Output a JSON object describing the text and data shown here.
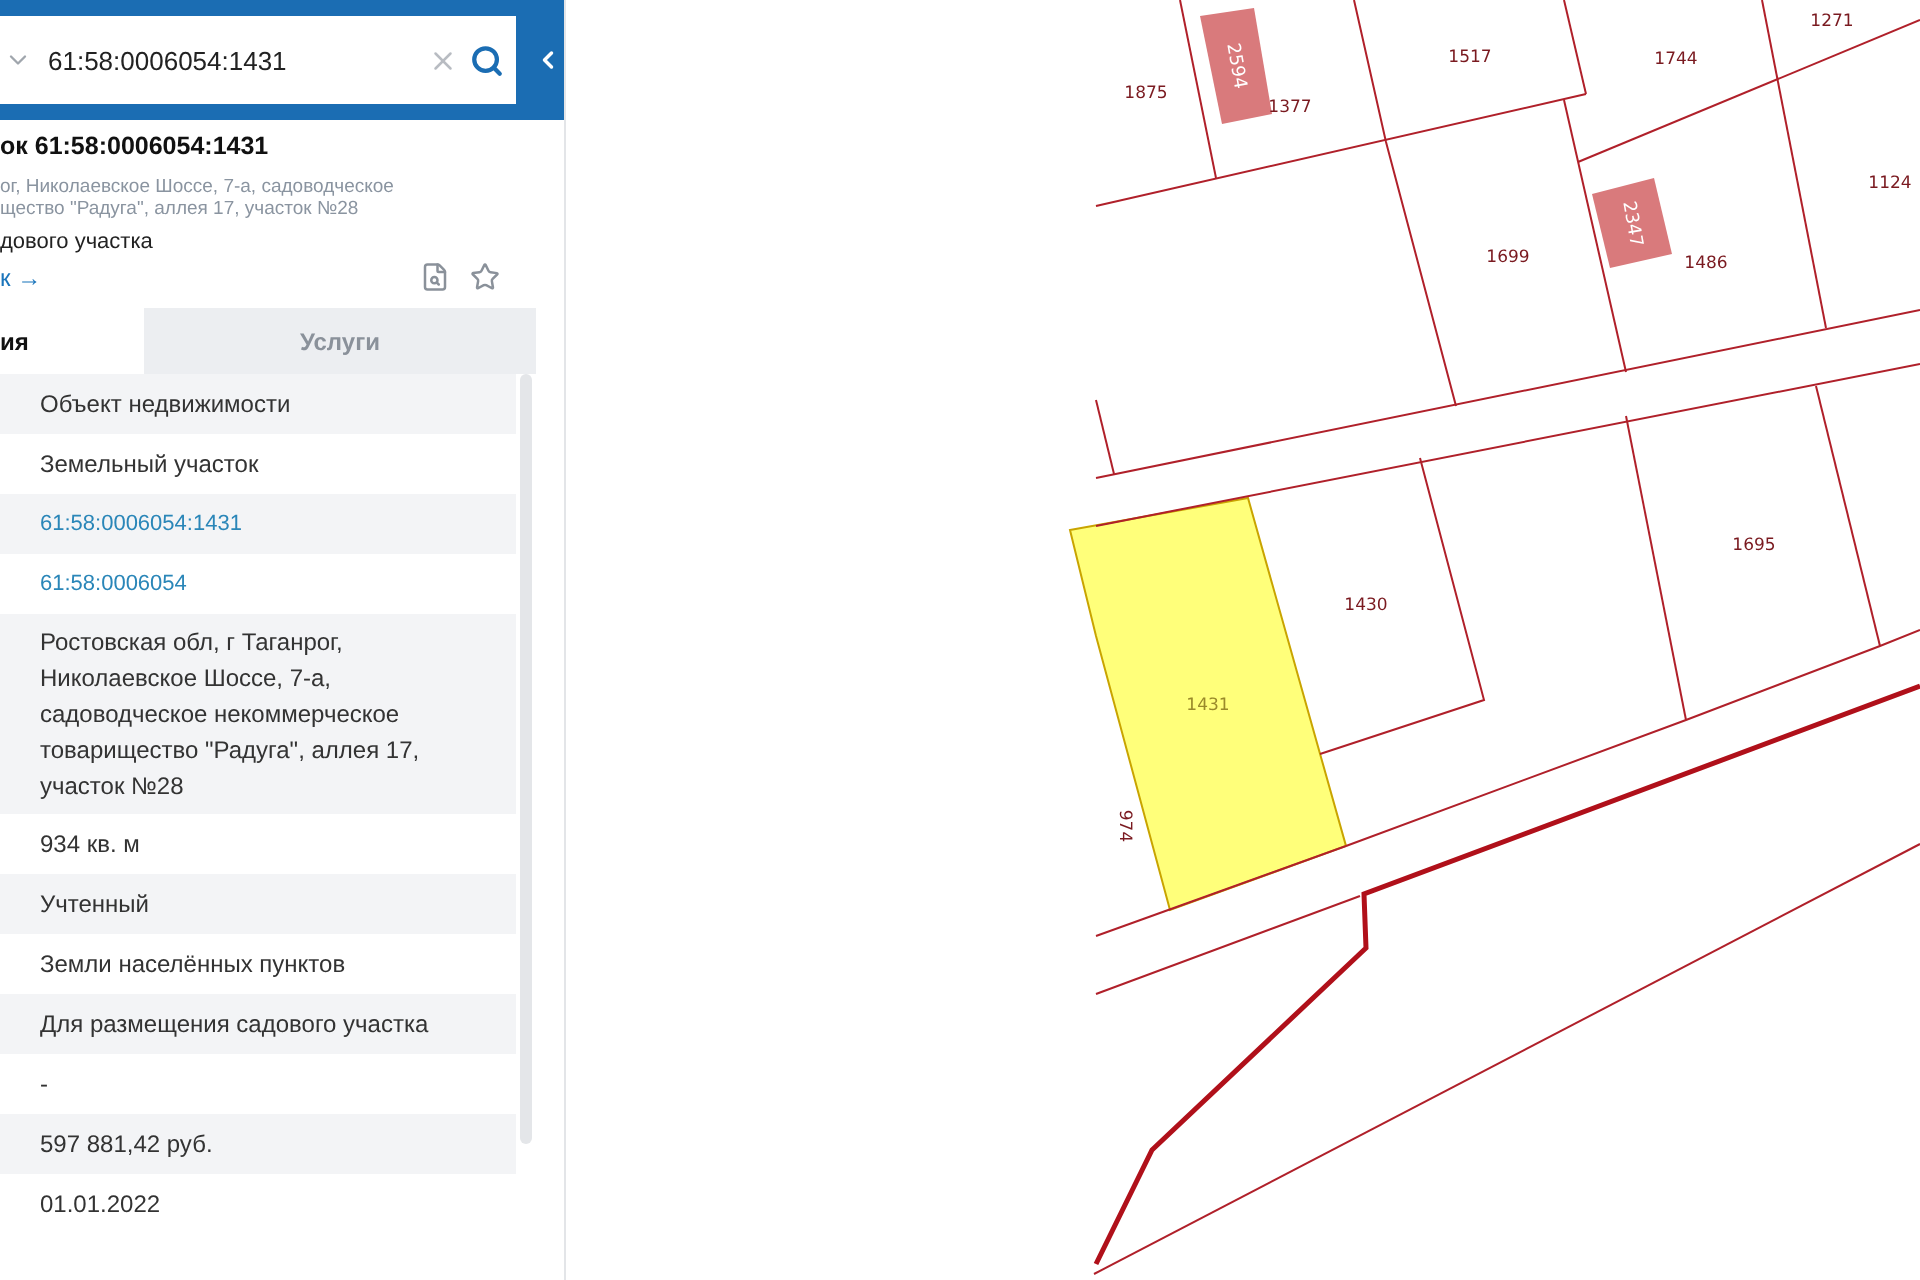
{
  "search": {
    "value": "61:58:0006054:1431"
  },
  "card": {
    "title": "ок 61:58:0006054:1431",
    "address_lines": [
      "ог, Николаевское Шоссе, 7-а, садоводческое",
      "щество \"Радуга\", аллея 17, участок №28"
    ],
    "purpose": "дового участка",
    "link": "к →"
  },
  "tabs": [
    {
      "label": "ия",
      "selected": true
    },
    {
      "label": "Услуги",
      "selected": false
    }
  ],
  "rows": [
    {
      "kind": "text",
      "value": "Объект недвижимости"
    },
    {
      "kind": "text",
      "value": "Земельный участок"
    },
    {
      "kind": "link",
      "value": "61:58:0006054:1431"
    },
    {
      "kind": "link",
      "value": "61:58:0006054"
    },
    {
      "kind": "text",
      "value": "Ростовская обл, г Таганрог, Николаевское Шоссе, 7-а, садоводческое некоммерческое товарищество \"Радуга\", аллея 17, участок №28"
    },
    {
      "kind": "text",
      "value": "934 кв. м"
    },
    {
      "kind": "text",
      "value": "Учтенный"
    },
    {
      "kind": "text",
      "value": "Земли населённых пунктов"
    },
    {
      "kind": "text",
      "value": "Для размещения садового участка"
    },
    {
      "kind": "text",
      "value": "-"
    },
    {
      "kind": "text",
      "value": "597 881,42 руб."
    },
    {
      "kind": "text",
      "value": "01.01.2022"
    }
  ],
  "map": {
    "parcels": [
      {
        "label": "1875",
        "selected": false
      },
      {
        "label": "1377",
        "selected": false
      },
      {
        "label": "1517",
        "selected": false
      },
      {
        "label": "1744",
        "selected": false
      },
      {
        "label": "1271",
        "selected": false
      },
      {
        "label": "1124",
        "selected": false
      },
      {
        "label": "1699",
        "selected": false
      },
      {
        "label": "1486",
        "selected": false
      },
      {
        "label": "1695",
        "selected": false
      },
      {
        "label": "1430",
        "selected": false
      },
      {
        "label": "1431",
        "selected": true
      },
      {
        "label": "974",
        "selected": false
      }
    ],
    "buildings": [
      {
        "label": "2594"
      },
      {
        "label": "2347"
      }
    ]
  }
}
